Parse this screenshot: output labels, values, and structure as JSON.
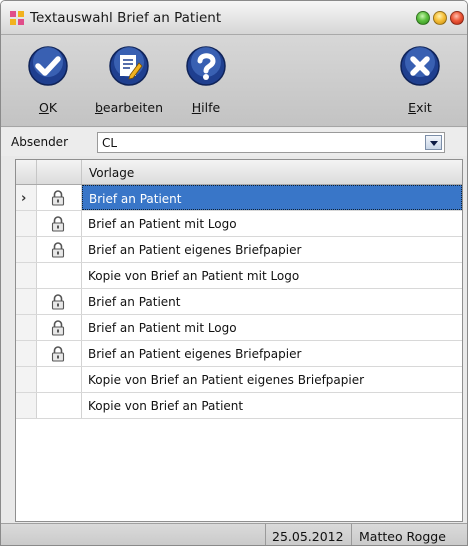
{
  "window": {
    "title": "Textauswahl Brief an Patient"
  },
  "toolbar": {
    "ok": {
      "mnemonic": "O",
      "rest": "K",
      "icon": "checkmark-icon"
    },
    "edit": {
      "mnemonic": "b",
      "rest": "earbeiten",
      "icon": "edit-document-icon"
    },
    "help": {
      "mnemonic": "H",
      "rest": "ilfe",
      "icon": "question-icon"
    },
    "exit": {
      "mnemonic": "E",
      "rest": "xit",
      "icon": "close-x-icon"
    }
  },
  "absender": {
    "label": "Absender",
    "value": "CL"
  },
  "grid": {
    "header": {
      "vorlage": "Vorlage"
    },
    "rows": [
      {
        "text": "Brief an Patient",
        "locked": true,
        "selected": true,
        "current": true
      },
      {
        "text": "Brief an Patient mit Logo",
        "locked": true
      },
      {
        "text": "Brief an Patient eigenes Briefpapier",
        "locked": true
      },
      {
        "text": "Kopie von Brief an Patient mit Logo",
        "locked": false
      },
      {
        "text": "Brief an Patient",
        "locked": true
      },
      {
        "text": "Brief an Patient mit Logo",
        "locked": true
      },
      {
        "text": "Brief an Patient eigenes Briefpapier",
        "locked": true
      },
      {
        "text": "Kopie von Brief an Patient eigenes Briefpapier",
        "locked": false
      },
      {
        "text": "Kopie von Brief an Patient",
        "locked": false
      }
    ],
    "current_row_marker": "›"
  },
  "status": {
    "date": "25.05.2012",
    "user": "Matteo Rogge"
  },
  "colors": {
    "accent": "#3976c8",
    "icon_blue": "#1f3f8f"
  }
}
